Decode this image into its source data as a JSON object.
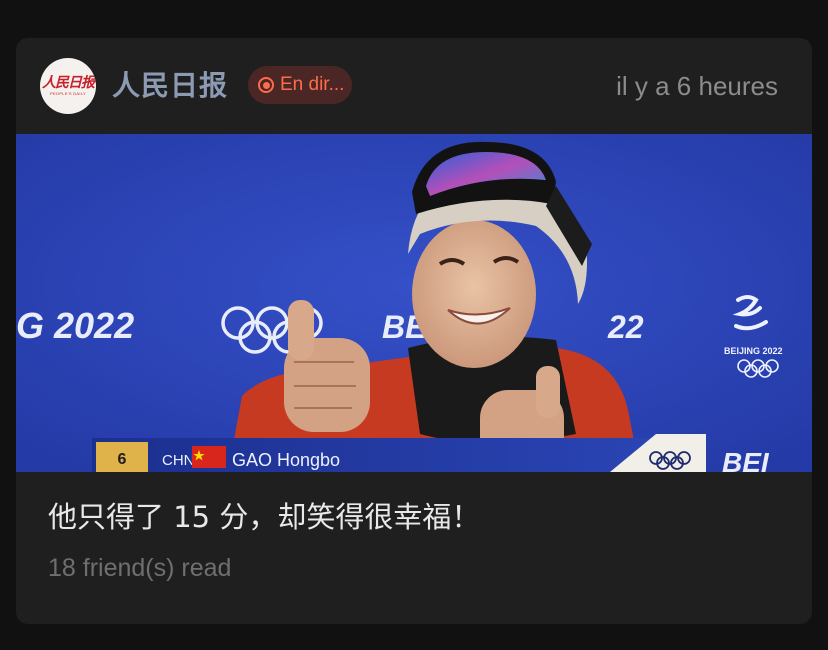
{
  "source": {
    "name": "人民日报",
    "logo_text": "人民日报",
    "logo_subtext": "PEOPLE'S DAILY",
    "live_label": "En dir...",
    "timestamp": "il y a 6 heures"
  },
  "thumbnail": {
    "left_banner_text": "G 2022",
    "mid_banner_text": "BE",
    "right_banner_text": "22",
    "right_logo_caption": "BEIJING 2022",
    "bottom_right_text": "BEI",
    "lower_third": {
      "rank": "6",
      "country": "CHN",
      "athlete": "GAO Hongbo"
    }
  },
  "post": {
    "headline": "他只得了 15 分，却笑得很幸福！",
    "read_count_text": "18 friend(s) read"
  },
  "colors": {
    "background": "#111111",
    "card": "#1f1f1f",
    "source_name": "#8d9ab3",
    "live_accent": "#ff6b4d",
    "backdrop_blue": "#2c43b8"
  },
  "icons": [
    "live-dot-icon",
    "olympic-rings-icon",
    "china-flag-icon"
  ]
}
